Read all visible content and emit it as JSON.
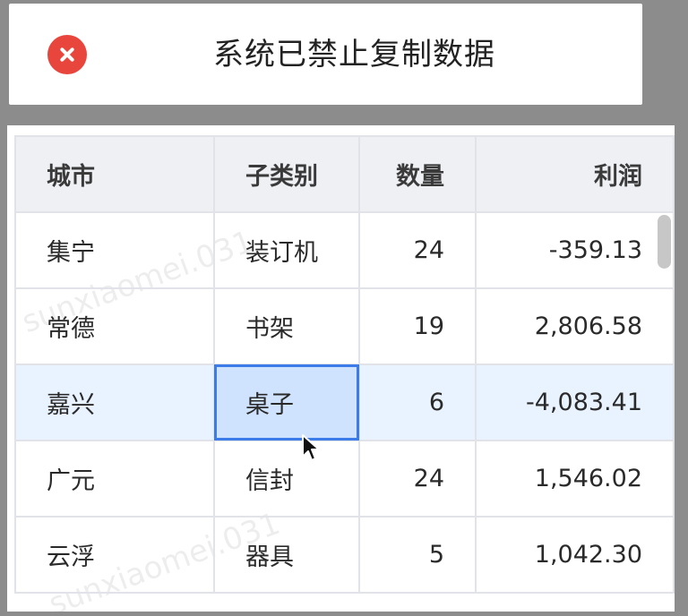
{
  "toast": {
    "message": "系统已禁止复制数据",
    "icon": "error-icon",
    "icon_color": "#e8453c"
  },
  "table": {
    "headers": [
      "城市",
      "子类别",
      "数量",
      "利润"
    ],
    "rows": [
      {
        "city": "集宁",
        "subcategory": "装订机",
        "quantity": "24",
        "profit": "-359.13"
      },
      {
        "city": "常德",
        "subcategory": "书架",
        "quantity": "19",
        "profit": "2,806.58"
      },
      {
        "city": "嘉兴",
        "subcategory": "桌子",
        "quantity": "6",
        "profit": "-4,083.41"
      },
      {
        "city": "广元",
        "subcategory": "信封",
        "quantity": "24",
        "profit": "1,546.02"
      },
      {
        "city": "云浮",
        "subcategory": "器具",
        "quantity": "5",
        "profit": "1,042.30"
      }
    ]
  },
  "watermark": "sunxiaomei.031",
  "colors": {
    "selection_border": "#3b7ce8",
    "row_highlight": "#e9f2ff"
  }
}
